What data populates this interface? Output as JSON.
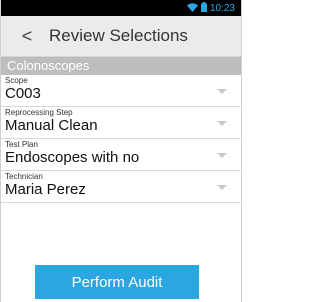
{
  "status_bar": {
    "time": "10:23",
    "accent": "#2aa6e0",
    "icons": [
      "wifi-icon",
      "battery-icon"
    ]
  },
  "app_bar": {
    "back_label": "<",
    "title": "Review Selections"
  },
  "section": {
    "title": "Colonoscopes"
  },
  "fields": [
    {
      "label": "Scope",
      "value": "C003"
    },
    {
      "label": "Reprocessing Step",
      "value": "Manual Clean"
    },
    {
      "label": "Test Plan",
      "value": "Endoscopes with no"
    },
    {
      "label": "Technician",
      "value": "Maria Perez"
    }
  ],
  "actions": {
    "perform_audit_label": "Perform Audit"
  },
  "colors": {
    "section_header": "#bdbdbd",
    "button": "#2aa6e0"
  }
}
